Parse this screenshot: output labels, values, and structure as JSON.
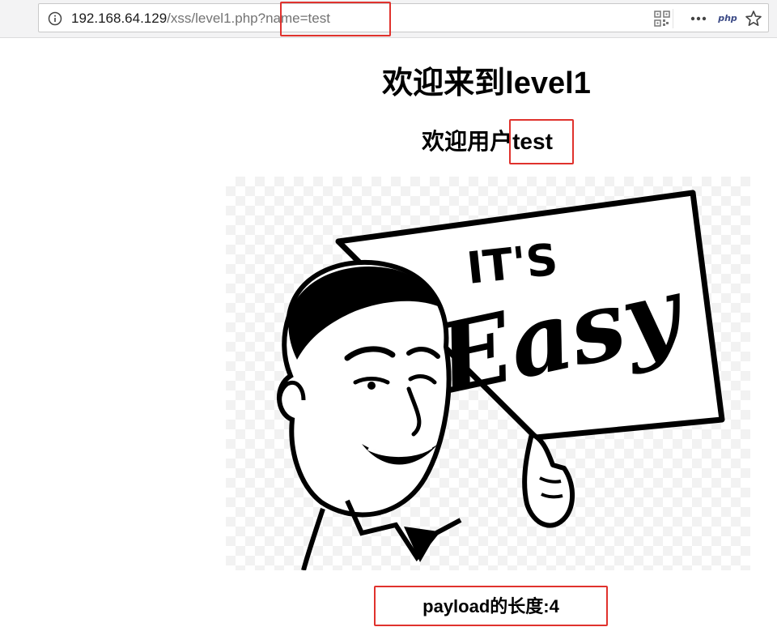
{
  "browser": {
    "url_host": "192.168.64.129",
    "url_path": "/xss/level1.php?",
    "url_query": "name=test",
    "php_badge": "php"
  },
  "page": {
    "title": "欢迎来到level1",
    "welcome_prefix": "欢迎用户",
    "welcome_name": "test",
    "payload_label": "payload的长度:4"
  },
  "image": {
    "sign_line1": "IT'S",
    "sign_line2": "Easy"
  },
  "icons": [
    "info-icon",
    "qr-code-icon",
    "more-dots-icon",
    "php-icon",
    "star-icon"
  ],
  "colors": {
    "highlight_border": "#e0322d",
    "url_muted": "#737373"
  }
}
